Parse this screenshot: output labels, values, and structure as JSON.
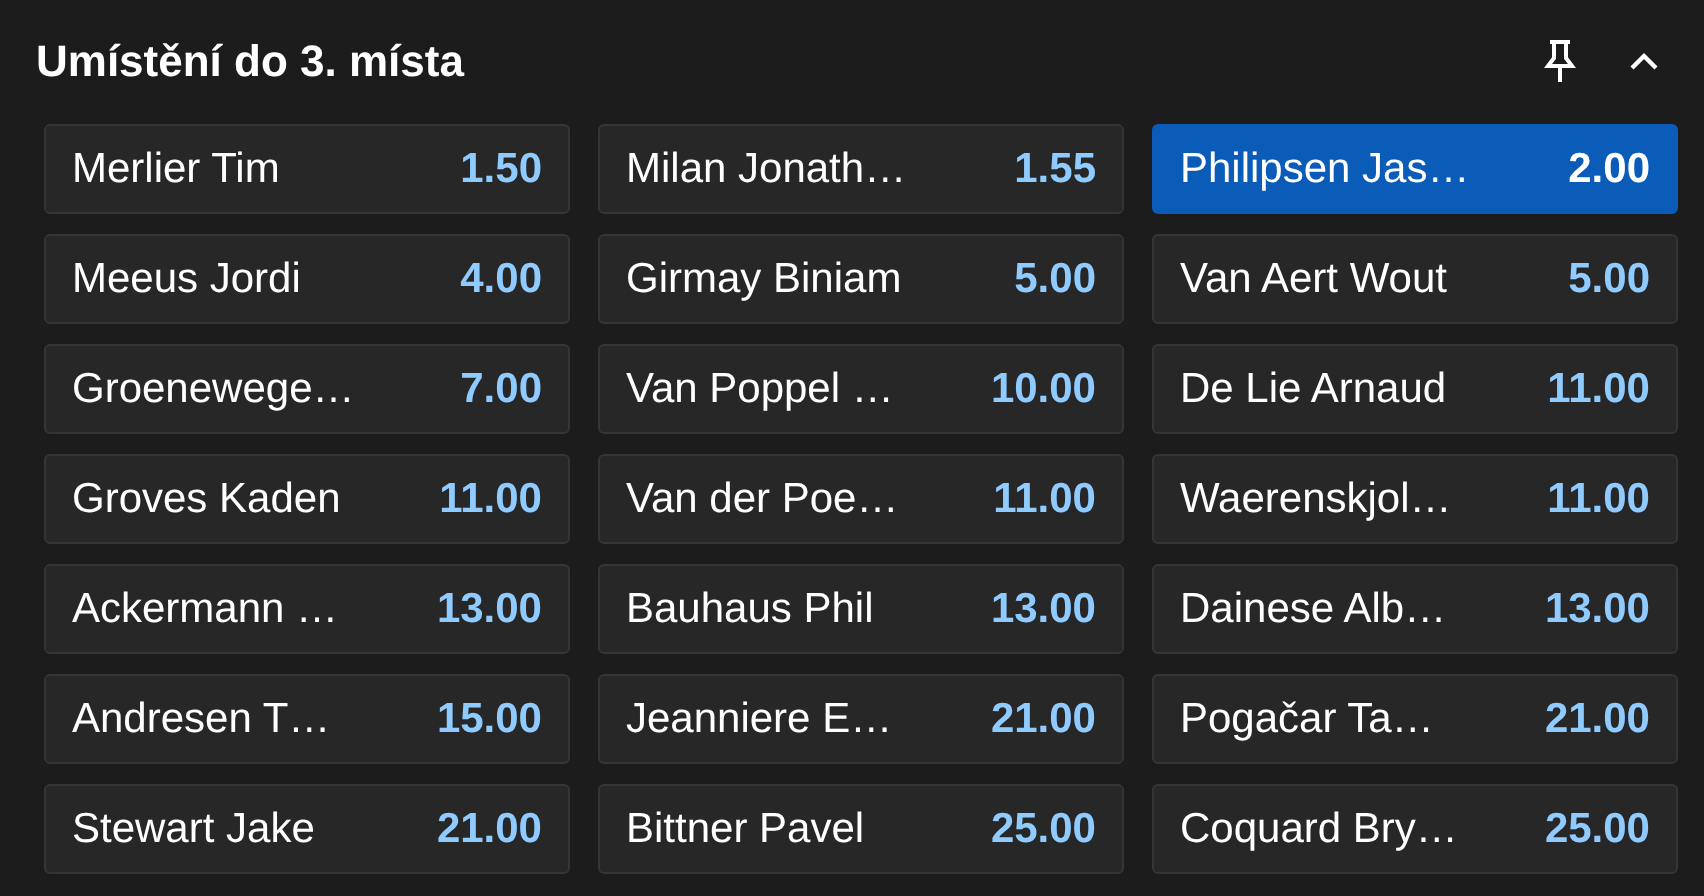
{
  "header": {
    "title": "Umístění do 3. místa"
  },
  "selections": [
    {
      "name": "Merlier Tim",
      "odds": "1.50",
      "selected": false
    },
    {
      "name": "Milan Jonath…",
      "odds": "1.55",
      "selected": false
    },
    {
      "name": "Philipsen Jas…",
      "odds": "2.00",
      "selected": true
    },
    {
      "name": "Meeus Jordi",
      "odds": "4.00",
      "selected": false
    },
    {
      "name": "Girmay Biniam",
      "odds": "5.00",
      "selected": false
    },
    {
      "name": "Van Aert Wout",
      "odds": "5.00",
      "selected": false
    },
    {
      "name": "Groenewege…",
      "odds": "7.00",
      "selected": false
    },
    {
      "name": "Van Poppel …",
      "odds": "10.00",
      "selected": false
    },
    {
      "name": "De Lie Arnaud",
      "odds": "11.00",
      "selected": false
    },
    {
      "name": "Groves Kaden",
      "odds": "11.00",
      "selected": false
    },
    {
      "name": "Van der Poe…",
      "odds": "11.00",
      "selected": false
    },
    {
      "name": "Waerenskjol…",
      "odds": "11.00",
      "selected": false
    },
    {
      "name": "Ackermann …",
      "odds": "13.00",
      "selected": false
    },
    {
      "name": "Bauhaus Phil",
      "odds": "13.00",
      "selected": false
    },
    {
      "name": "Dainese Alb…",
      "odds": "13.00",
      "selected": false
    },
    {
      "name": "Andresen T…",
      "odds": "15.00",
      "selected": false
    },
    {
      "name": "Jeanniere E…",
      "odds": "21.00",
      "selected": false
    },
    {
      "name": "Pogačar Ta…",
      "odds": "21.00",
      "selected": false
    },
    {
      "name": "Stewart Jake",
      "odds": "21.00",
      "selected": false
    },
    {
      "name": "Bittner Pavel",
      "odds": "25.00",
      "selected": false
    },
    {
      "name": "Coquard Bry…",
      "odds": "25.00",
      "selected": false
    }
  ]
}
